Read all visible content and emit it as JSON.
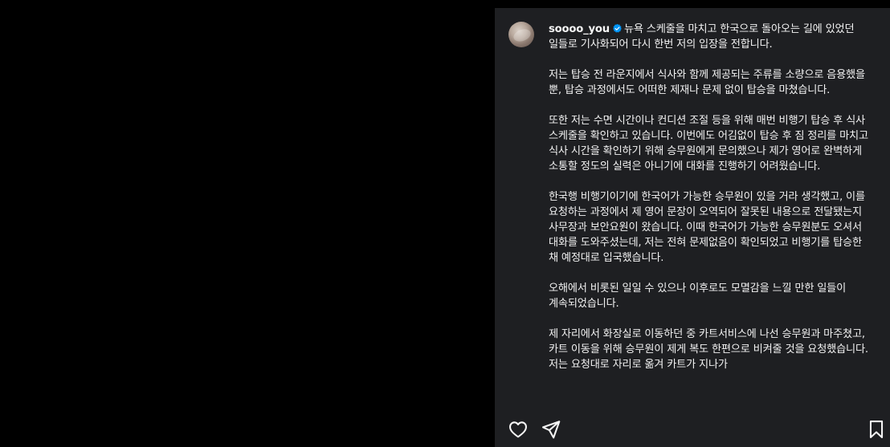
{
  "post": {
    "username": "soooo_you",
    "verified": true,
    "paragraphs": [
      "뉴욕 스케줄을 마치고 한국으로 돌아오는 길에 있었던 일들로 기사화되어 다시 한번 저의 입장을 전합니다.",
      "저는 탑승 전 라운지에서 식사와 함께 제공되는 주류를 소량으로 음용했을 뿐, 탑승 과정에서도 어떠한 제재나 문제 없이 탑승을 마쳤습니다.",
      "또한 저는 수면 시간이나 컨디션 조절 등을 위해 매번 비행기 탑승 후 식사 스케줄을 확인하고 있습니다. 이번에도 어김없이 탑승 후 짐 정리를 마치고 식사 시간을 확인하기 위해 승무원에게 문의했으나 제가 영어로 완벽하게 소통할 정도의 실력은 아니기에 대화를 진행하기 어려웠습니다.",
      "한국행 비행기이기에 한국어가 가능한 승무원이 있을 거라 생각했고, 이를 요청하는 과정에서 제 영어 문장이 오역되어 잘못된 내용으로 전달됐는지 사무장과 보안요원이 왔습니다. 이때 한국어가 가능한 승무원분도 오셔서 대화를 도와주셨는데, 저는 전혀 문제없음이 확인되었고 비행기를 탑승한 채 예정대로 입국했습니다.",
      "오해에서 비롯된 일일 수 있으나 이후로도 모멸감을 느낄 만한 일들이 계속되었습니다.",
      "제 자리에서 화장실로 이동하던 중 카트서비스에 나선 승무원과 마주쳤고, 카트 이동을 위해 승무원이 제게 복도 한편으로 비켜줄 것을 요청했습니다. 저는 요청대로 자리로 옮겨 카트가 지나가"
    ]
  },
  "icons": {
    "verified": "verified-badge-icon",
    "like": "heart-icon",
    "share": "paper-plane-icon",
    "save": "bookmark-icon"
  },
  "colors": {
    "panel_bg": "#1e1f22",
    "media_bg": "#000000",
    "text": "#f2f2f2",
    "verified": "#0095f6"
  }
}
